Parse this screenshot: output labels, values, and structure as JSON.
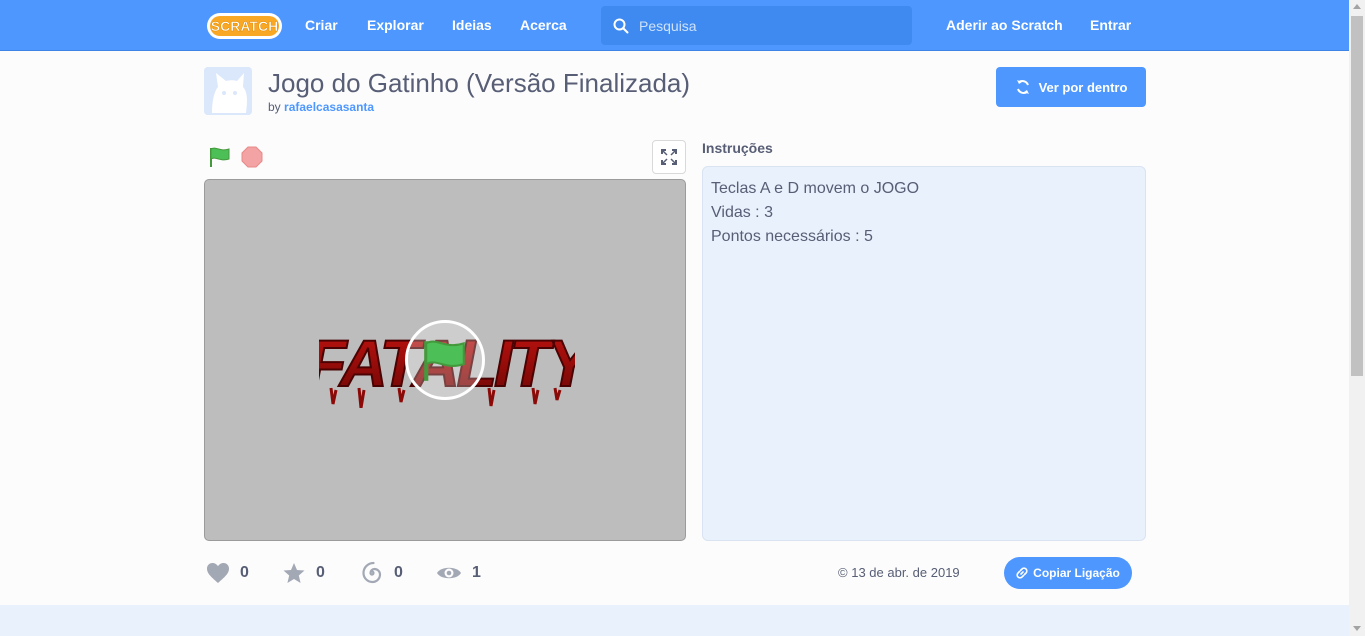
{
  "navbar": {
    "logo_text": "SCRATCH",
    "links": [
      "Criar",
      "Explorar",
      "Ideias",
      "Acerca"
    ],
    "search_placeholder": "Pesquisa",
    "join": "Aderir ao Scratch",
    "signin": "Entrar",
    "color": "#4d97ff"
  },
  "project": {
    "title": "Jogo do Gatinho (Versão Finalizada)",
    "by": "by",
    "author": "rafaelcasasanta",
    "see_inside": "Ver por dentro"
  },
  "stage": {
    "splash_text": "FATALITY"
  },
  "instructions": {
    "heading": "Instruções",
    "lines": [
      "Teclas A e D movem o JOGO",
      "Vidas : 3",
      "Pontos necessários : 5"
    ]
  },
  "stats": {
    "loves": "0",
    "favorites": "0",
    "remixes": "0",
    "views": "1"
  },
  "date": "13 de abr. de 2019",
  "copy_link": "Copiar Ligação"
}
